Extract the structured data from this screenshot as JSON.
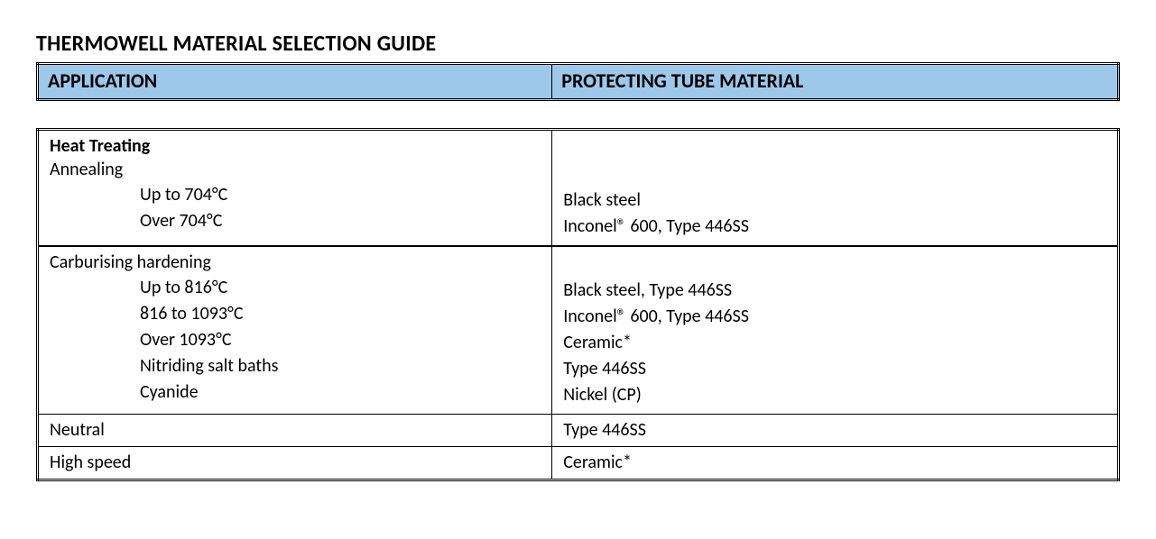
{
  "title": "THERMOWELL MATERIAL SELECTION GUIDE",
  "header": {
    "application": "APPLICATION",
    "material": "PROTECTING TUBE MATERIAL"
  },
  "sections": [
    {
      "heading": "Heat Treating",
      "sub": "Annealing",
      "items": [
        {
          "cond": "Up to 704°C",
          "mat": "Black steel"
        },
        {
          "cond": "Over  704°C",
          "mat": "Inconel® 600, Type 446SS"
        }
      ]
    },
    {
      "heading": "",
      "sub": "Carburising hardening",
      "items": [
        {
          "cond": "Up to 816°C",
          "mat": "Black steel, Type 446SS"
        },
        {
          "cond": "816 to 1093°C",
          "mat": "Inconel® 600, Type 446SS"
        },
        {
          "cond": "Over 1093°C",
          "mat": "Ceramic*"
        },
        {
          "cond": "Nitriding salt baths",
          "mat": "Type 446SS"
        },
        {
          "cond": " Cyanide",
          "mat": "Nickel (CP)"
        }
      ]
    }
  ],
  "simple_rows": [
    {
      "app": "Neutral",
      "mat": "Type 446SS"
    },
    {
      "app": "High speed",
      "mat": "Ceramic*"
    }
  ]
}
